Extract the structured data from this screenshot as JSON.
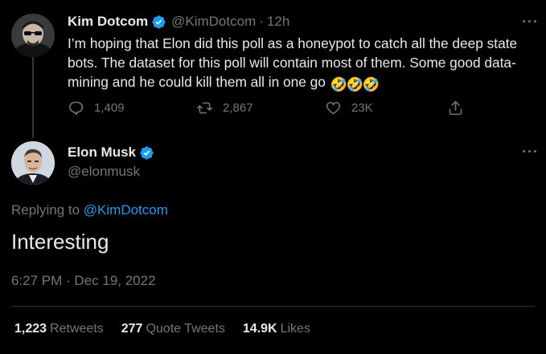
{
  "parent_tweet": {
    "name": "Kim Dotcom",
    "handle": "@KimDotcom",
    "separator": "·",
    "time": "12h",
    "text": "I’m hoping that Elon did this poll as a honeypot to catch all the deep state bots. The dataset for this poll will contain most of them. Some good data-mining and he could kill them all in one go",
    "emoji": [
      "🤣",
      "🤣",
      "🤣"
    ],
    "replies": "1,409",
    "retweets": "2,867",
    "likes": "23K"
  },
  "main_tweet": {
    "name": "Elon Musk",
    "handle": "@elonmusk",
    "replying_prefix": "Replying to ",
    "replying_handle": "@KimDotcom",
    "text": "Interesting",
    "timestamp": "6:27 PM · Dec 19, 2022",
    "stats": [
      {
        "value": "1,223",
        "label": "Retweets"
      },
      {
        "value": "277",
        "label": "Quote Tweets"
      },
      {
        "value": "14.9K",
        "label": "Likes"
      }
    ]
  },
  "colors": {
    "background": "#000000",
    "text": "#e7e9ea",
    "muted": "#71767b",
    "link": "#1d9bf0",
    "verified": "#1d9bf0"
  }
}
